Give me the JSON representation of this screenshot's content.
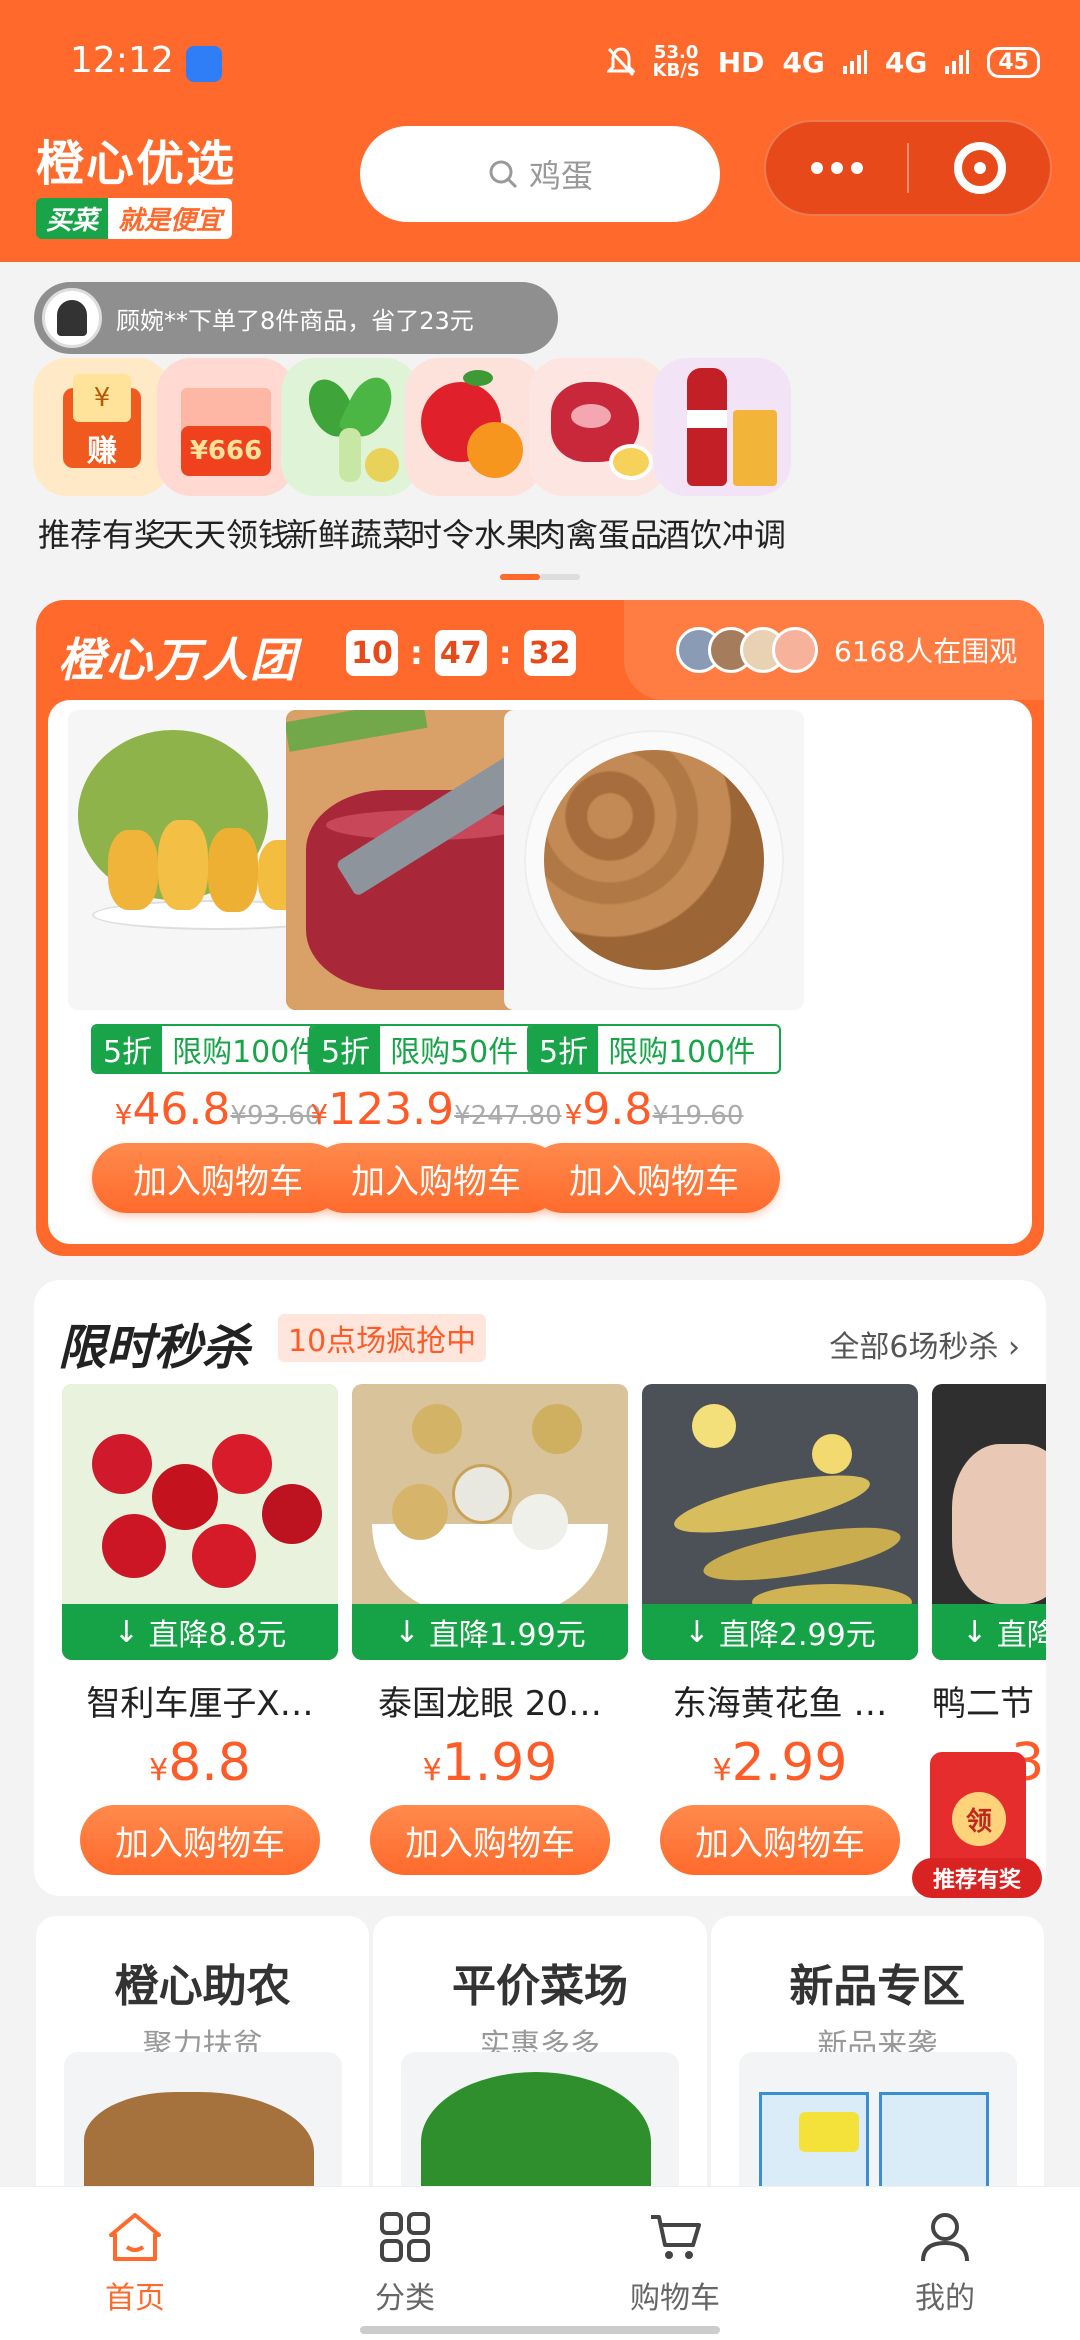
{
  "status_bar": {
    "time": "12:12",
    "net_speed_value": "53.0",
    "net_speed_unit": "KB/S",
    "hd": "HD",
    "sig1": "4G",
    "sig2": "4G",
    "battery": "45"
  },
  "header": {
    "logo_top": "橙心优选",
    "logo_bottom_a": "买菜",
    "logo_bottom_b": "就是便宜",
    "search_placeholder": "鸡蛋",
    "brand_color": "#ff6a2c"
  },
  "ticker": {
    "text": "顾婉**下单了8件商品，省了23元"
  },
  "categories": [
    {
      "label": "推荐有奖",
      "icon": "reward-icon",
      "glyph": "赚"
    },
    {
      "label": "天天领钱",
      "icon": "money-icon",
      "glyph": "¥666"
    },
    {
      "label": "新鲜蔬菜",
      "icon": "vegetable-icon"
    },
    {
      "label": "时令水果",
      "icon": "fruit-icon"
    },
    {
      "label": "肉禽蛋品",
      "icon": "meat-icon"
    },
    {
      "label": "酒饮冲调",
      "icon": "drink-icon"
    }
  ],
  "group_buy": {
    "title": "橙心万人团",
    "timer": {
      "h": "10",
      "m": "47",
      "s": "32"
    },
    "watchers": "6168人在围观",
    "items": [
      {
        "discount": "5折",
        "limit": "限购100件",
        "currency": "¥",
        "price": "46.8",
        "original": "¥93.60",
        "button": "加入购物车"
      },
      {
        "discount": "5折",
        "limit": "限购50件",
        "currency": "¥",
        "price": "123.9",
        "original": "¥247.80",
        "button": "加入购物车"
      },
      {
        "discount": "5折",
        "limit": "限购100件",
        "currency": "¥",
        "price": "9.8",
        "original": "¥19.60",
        "button": "加入购物车"
      }
    ]
  },
  "flash_sale": {
    "title": "限时秒杀",
    "badge": "10点场疯抢中",
    "view_all": "全部6场秒杀",
    "items": [
      {
        "drop": "直降8.8元",
        "name": "智利车厘子X…",
        "currency": "¥",
        "price": "8.8",
        "button": "加入购物车"
      },
      {
        "drop": "直降1.99元",
        "name": "泰国龙眼 20…",
        "currency": "¥",
        "price": "1.99",
        "button": "加入购物车"
      },
      {
        "drop": "直降2.99元",
        "name": "东海黄花鱼 …",
        "currency": "¥",
        "price": "2.99",
        "button": "加入购物车"
      },
      {
        "drop": "直降",
        "name": "鸭二节",
        "currency": "¥",
        "price": "3",
        "button": "加入购物车"
      }
    ]
  },
  "floating_reward": {
    "seal": "领",
    "label": "推荐有奖"
  },
  "sections": [
    {
      "title": "橙心助农",
      "subtitle": "聚力扶贫"
    },
    {
      "title": "平价菜场",
      "subtitle": "实惠多多"
    },
    {
      "title": "新品专区",
      "subtitle": "新品来袭"
    }
  ],
  "tabbar": [
    {
      "label": "首页",
      "active": true
    },
    {
      "label": "分类",
      "active": false
    },
    {
      "label": "购物车",
      "active": false
    },
    {
      "label": "我的",
      "active": false
    }
  ]
}
